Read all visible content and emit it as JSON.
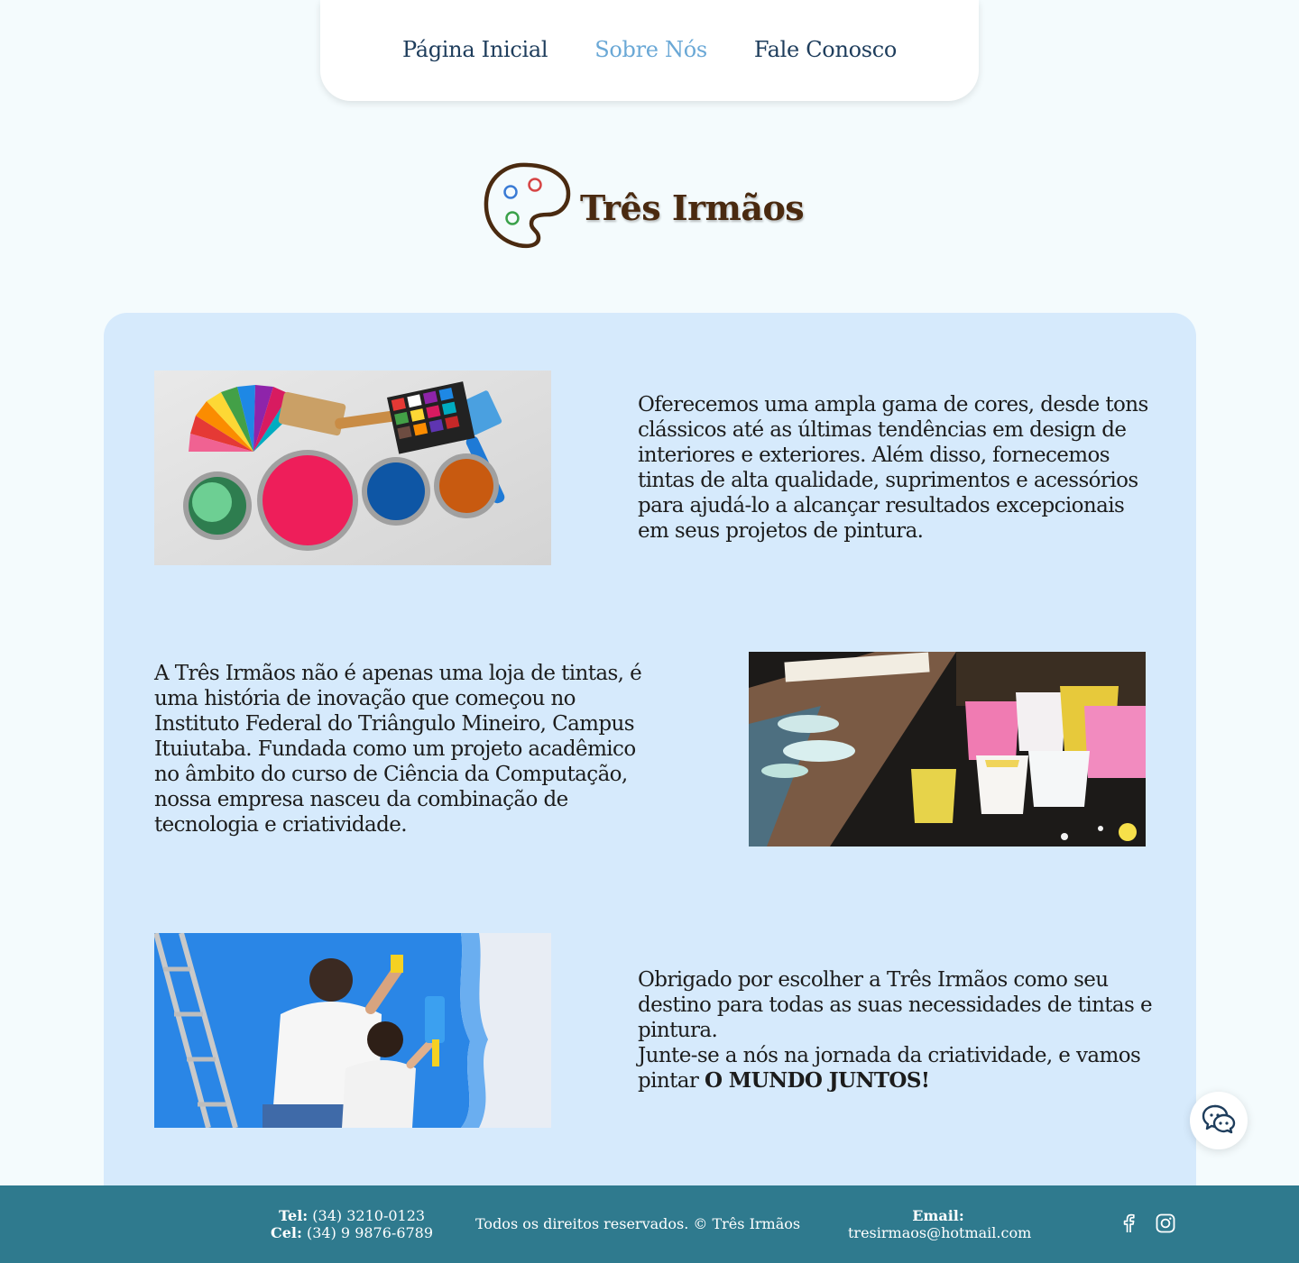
{
  "nav": {
    "items": [
      {
        "label": "Página Inicial",
        "active": false
      },
      {
        "label": "Sobre Nós",
        "active": true
      },
      {
        "label": "Fale Conosco",
        "active": false
      }
    ]
  },
  "brand": {
    "title": "Três Irmãos",
    "logo_icon": "palette-icon"
  },
  "sections": [
    {
      "text": "Oferecemos uma ampla gama de cores, desde tons clássicos até as últimas tendências em design de interiores e exteriores. Além disso, fornecemos tintas de alta qualidade, suprimentos e acessórios para ajudá-lo a alcançar resultados excepcionais em seus projetos de pintura."
    },
    {
      "text": "A Três Irmãos não é apenas uma loja de tintas, é uma história de inovação que começou no Instituto Federal do Triângulo Mineiro, Campus Ituiutaba. Fundada como um projeto acadêmico no âmbito do curso de Ciência da Computação, nossa empresa nasceu da combinação de tecnologia e criatividade."
    },
    {
      "text_line1": "Obrigado por escolher a Três Irmãos como seu destino para todas as suas necessidades de tintas e pintura.",
      "text_line2": "Junte-se a nós na jornada da criatividade, e vamos pintar ",
      "text_bold": "O MUNDO JUNTOS!"
    }
  ],
  "chat": {
    "icon": "chat-bubbles-icon"
  },
  "footer": {
    "tel_label": "Tel:",
    "tel": "(34) 3210-0123",
    "cel_label": "Cel:",
    "cel": "(34) 9 9876-6789",
    "copyright": "Todos os direitos reservados. © Três Irmãos",
    "email_label": "Email:",
    "email": "tresirmaos@hotmail.com",
    "social_icons": [
      "facebook-icon",
      "instagram-icon"
    ]
  },
  "colors": {
    "background": "#f4fbfd",
    "card": "#d6eafc",
    "footer": "#2f7a8e",
    "nav_text": "#1e3d5c",
    "nav_active": "#6aa8d6",
    "brand": "#4a2a10"
  }
}
